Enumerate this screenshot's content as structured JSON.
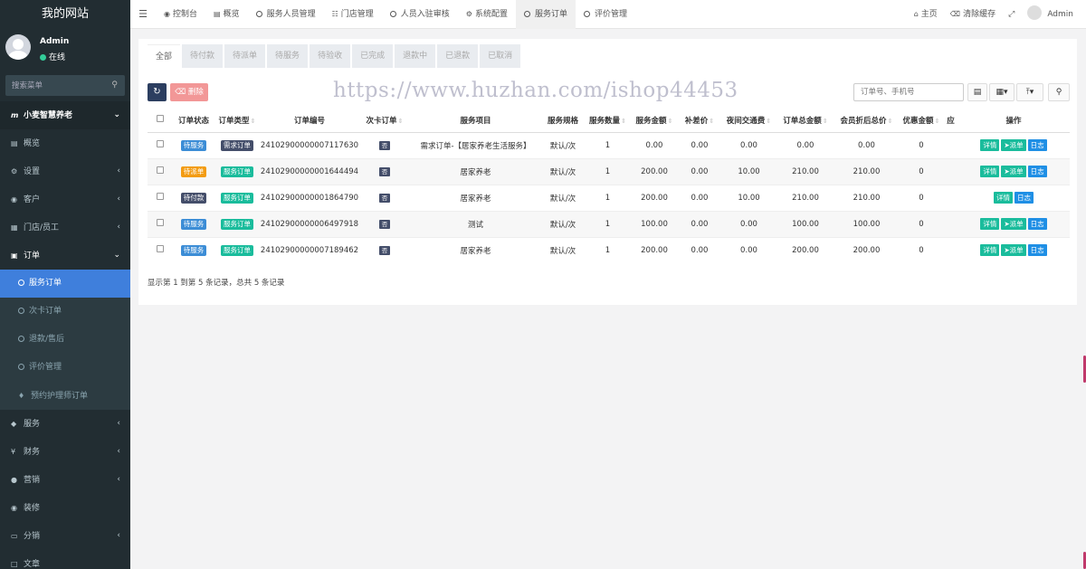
{
  "app": {
    "title": "我的网站"
  },
  "user": {
    "name": "Admin",
    "status": "在线"
  },
  "sidebar": {
    "search_placeholder": "搜索菜单",
    "items": [
      {
        "label": "小麦智慧养老",
        "icon": "m-logo-icon"
      },
      {
        "label": "概览",
        "icon": "chart-icon"
      },
      {
        "label": "设置",
        "icon": "gear-icon"
      },
      {
        "label": "客户",
        "icon": "user-icon"
      },
      {
        "label": "门店/员工",
        "icon": "bank-icon"
      },
      {
        "label": "订单",
        "icon": "file-icon"
      },
      {
        "label": "服务订单",
        "icon": "circle-icon"
      },
      {
        "label": "次卡订单",
        "icon": "circle-icon"
      },
      {
        "label": "退款/售后",
        "icon": "circle-icon"
      },
      {
        "label": "评价管理",
        "icon": "circle-icon"
      },
      {
        "label": "预约护理师订单",
        "icon": "drop-icon"
      },
      {
        "label": "服务",
        "icon": "diamond-icon"
      },
      {
        "label": "财务",
        "icon": "yen-icon"
      },
      {
        "label": "营销",
        "icon": "chat-icon"
      },
      {
        "label": "装修",
        "icon": "palette-icon"
      },
      {
        "label": "分销",
        "icon": "share-icon"
      },
      {
        "label": "文章",
        "icon": "doc-icon"
      }
    ]
  },
  "topbar": {
    "tabs": [
      {
        "label": "控制台",
        "icon": "dashboard-icon"
      },
      {
        "label": "概览",
        "icon": "chart-icon"
      },
      {
        "label": "服务人员管理",
        "icon": "circle-icon"
      },
      {
        "label": "门店管理",
        "icon": "sitemap-icon"
      },
      {
        "label": "人员入驻审核",
        "icon": "circle-icon"
      },
      {
        "label": "系统配置",
        "icon": "gear-icon"
      },
      {
        "label": "服务订单",
        "icon": "circle-icon"
      },
      {
        "label": "评价管理",
        "icon": "circle-icon"
      }
    ],
    "home_label": "主页",
    "clear_cache_label": "清除缓存",
    "user_label": "Admin"
  },
  "status_tabs": [
    "全部",
    "待付款",
    "待派单",
    "待服务",
    "待验收",
    "已完成",
    "退款中",
    "已退款",
    "已取消"
  ],
  "toolbar": {
    "delete_label": "删除",
    "search_placeholder": "订单号、手机号",
    "watermark": "https://www.huzhan.com/ishop44453"
  },
  "table": {
    "columns": [
      "订单状态",
      "订单类型",
      "订单编号",
      "次卡订单",
      "服务项目",
      "服务规格",
      "服务数量",
      "服务金额",
      "补差价",
      "夜间交通费",
      "订单总金额",
      "会员折后总价",
      "优惠金额",
      "应",
      "操作"
    ],
    "rows": [
      {
        "status": "待服务",
        "status_color": "#3c8dd6",
        "type": "需求订单",
        "type_color": "#444e6a",
        "order_no": "24102900000007117630",
        "card": "否",
        "item": "需求订单-【居家养老生活服务】",
        "spec": "默认/次",
        "qty": "1",
        "amount": "0.00",
        "diff": "0.00",
        "night": "0.00",
        "total": "0.00",
        "member": "0.00",
        "discount": "0",
        "actions": [
          "详情",
          "派单",
          "日志"
        ]
      },
      {
        "status": "待派单",
        "status_color": "#f39c12",
        "type": "服务订单",
        "type_color": "#1abc9c",
        "order_no": "24102900000001644494",
        "card": "否",
        "item": "居家养老",
        "spec": "默认/次",
        "qty": "1",
        "amount": "200.00",
        "diff": "0.00",
        "night": "10.00",
        "total": "210.00",
        "member": "210.00",
        "discount": "0",
        "actions": [
          "详情",
          "派单",
          "日志"
        ]
      },
      {
        "status": "待付款",
        "status_color": "#444e6a",
        "type": "服务订单",
        "type_color": "#1abc9c",
        "order_no": "24102900000001864790",
        "card": "否",
        "item": "居家养老",
        "spec": "默认/次",
        "qty": "1",
        "amount": "200.00",
        "diff": "0.00",
        "night": "10.00",
        "total": "210.00",
        "member": "210.00",
        "discount": "0",
        "actions": [
          "详情",
          "日志"
        ]
      },
      {
        "status": "待服务",
        "status_color": "#3c8dd6",
        "type": "服务订单",
        "type_color": "#1abc9c",
        "order_no": "24102900000006497918",
        "card": "否",
        "item": "测试",
        "spec": "默认/次",
        "qty": "1",
        "amount": "100.00",
        "diff": "0.00",
        "night": "0.00",
        "total": "100.00",
        "member": "100.00",
        "discount": "0",
        "actions": [
          "详情",
          "派单",
          "日志"
        ]
      },
      {
        "status": "待服务",
        "status_color": "#3c8dd6",
        "type": "服务订单",
        "type_color": "#1abc9c",
        "order_no": "24102900000007189462",
        "card": "否",
        "item": "居家养老",
        "spec": "默认/次",
        "qty": "1",
        "amount": "200.00",
        "diff": "0.00",
        "night": "0.00",
        "total": "200.00",
        "member": "200.00",
        "discount": "0",
        "actions": [
          "详情",
          "派单",
          "日志"
        ]
      }
    ],
    "footer": "显示第 1 到第 5 条记录，总共 5 条记录"
  }
}
